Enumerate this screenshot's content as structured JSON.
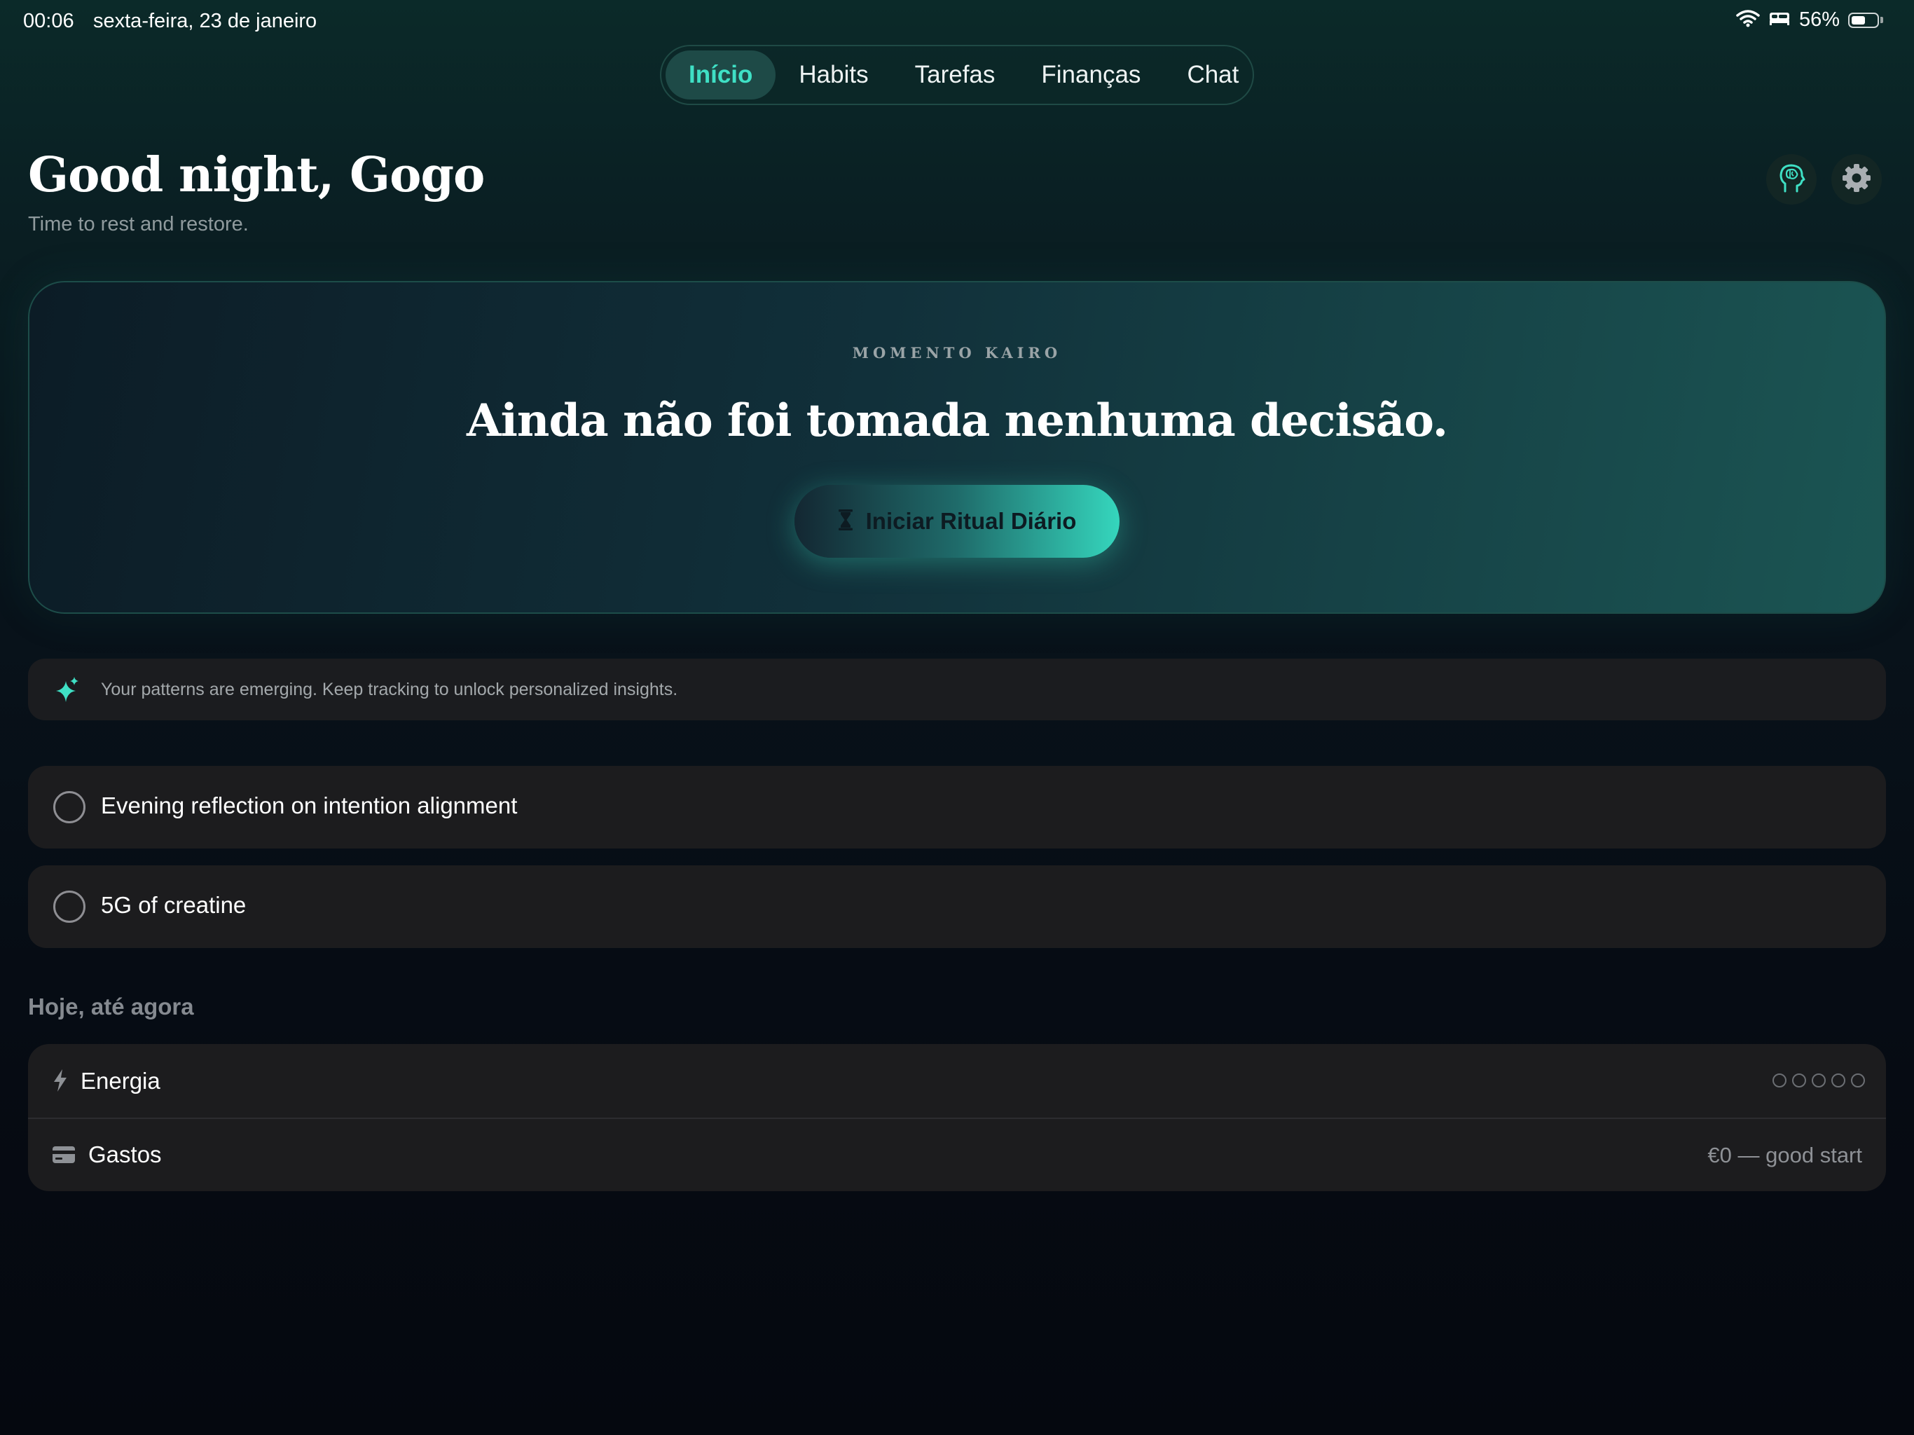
{
  "status_bar": {
    "time": "00:06",
    "date": "sexta-feira, 23 de janeiro",
    "battery_percent": "56%",
    "battery_level": 0.56,
    "icons": [
      "wifi-icon",
      "bed-icon",
      "battery-icon"
    ]
  },
  "tabs": [
    {
      "label": "Início",
      "active": true
    },
    {
      "label": "Habits",
      "active": false
    },
    {
      "label": "Tarefas",
      "active": false
    },
    {
      "label": "Finanças",
      "active": false
    },
    {
      "label": "Chat",
      "active": false
    }
  ],
  "header": {
    "greeting": "Good night, Gogo",
    "subtitle": "Time to rest and restore.",
    "icons": [
      "brain-head-icon",
      "gear-icon"
    ]
  },
  "hero": {
    "eyebrow": "MOMENTO KAIRO",
    "title": "Ainda não foi tomada nenhuma decisão.",
    "button_label": "Iniciar Ritual Diário",
    "button_icon": "hourglass-icon"
  },
  "insight": {
    "icon": "sparkle-icon",
    "text": "Your patterns are emerging. Keep tracking to unlock personalized insights."
  },
  "tasks": [
    {
      "label": "Evening reflection on intention alignment",
      "done": false
    },
    {
      "label": "5G of creatine",
      "done": false
    }
  ],
  "today": {
    "title": "Hoje, até agora",
    "energy": {
      "label": "Energia",
      "icon": "bolt-icon",
      "level": 0,
      "max": 5
    },
    "expenses": {
      "label": "Gastos",
      "icon": "card-icon",
      "value": "€0 — good start"
    }
  },
  "colors": {
    "accent": "#3fe0c5",
    "card": "#1c1c1e",
    "muted_text": "#8e9196"
  }
}
